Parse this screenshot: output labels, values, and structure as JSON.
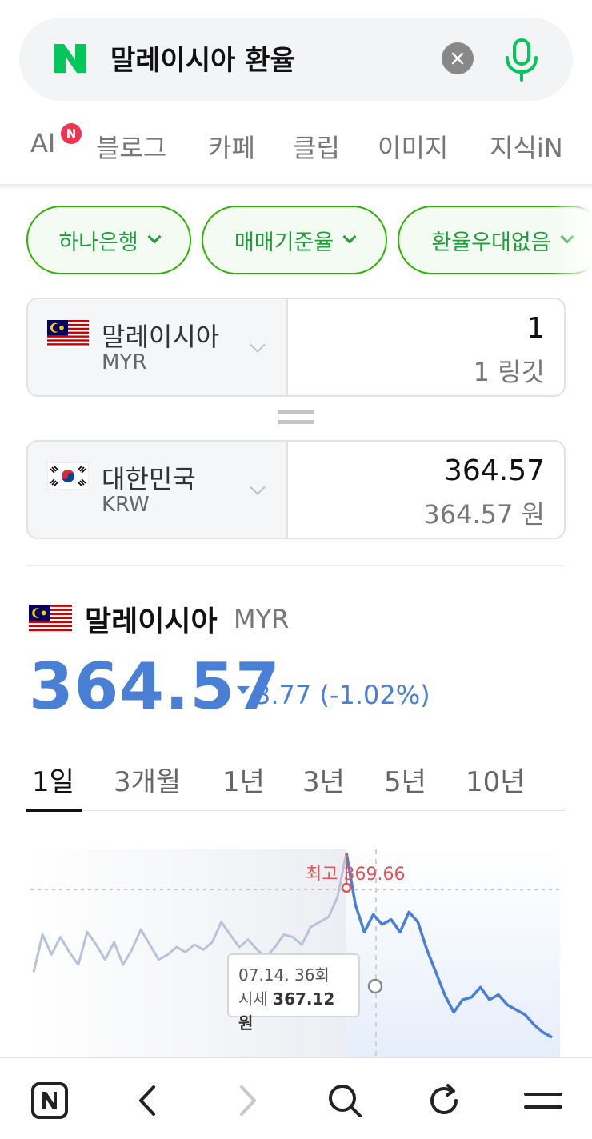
{
  "search": {
    "query": "말레이시아 환율",
    "colors": {
      "brand": "#03c75a",
      "mic": "#03c75a"
    }
  },
  "tabs": [
    {
      "label": "AI",
      "badge": "N"
    },
    {
      "label": "블로그"
    },
    {
      "label": "카페"
    },
    {
      "label": "클립"
    },
    {
      "label": "이미지"
    },
    {
      "label": "지식iN"
    }
  ],
  "filters": {
    "bank": "하나은행",
    "rate_type": "매매기준율",
    "discount": "환율우대없음"
  },
  "converter": {
    "from": {
      "country": "말레이시아",
      "code": "MYR",
      "amount": "1",
      "amount_text": "1 링깃"
    },
    "to": {
      "country": "대한민국",
      "code": "KRW",
      "amount": "364.57",
      "amount_text": "364.57 원"
    }
  },
  "rate": {
    "country": "말레이시아",
    "code": "MYR",
    "value": "364.57",
    "change": "3.77 (-1.02%)",
    "direction": "down"
  },
  "periods": [
    "1일",
    "3개월",
    "1년",
    "3년",
    "5년",
    "10년"
  ],
  "active_period": "1일",
  "chart_data": {
    "type": "line",
    "series": [
      {
        "values": [
          364.9,
          366.4,
          365.6,
          366.3,
          365.7,
          365.2,
          366.5,
          366.0,
          365.4,
          366.1,
          365.2,
          365.8,
          366.6,
          366.0,
          365.4,
          365.6,
          365.9,
          365.7,
          366.0,
          365.8,
          366.1,
          366.9,
          366.4,
          365.9,
          366.2,
          365.8,
          365.5,
          365.9,
          366.4,
          366.3,
          366.0,
          366.7,
          366.9,
          367.1,
          367.9,
          369.66,
          367.6,
          366.5,
          367.2,
          366.8,
          367.0,
          366.5,
          367.3,
          366.9,
          365.8,
          364.9,
          364.0,
          363.3,
          363.8,
          363.9,
          364.3,
          363.8,
          364.0,
          363.6,
          363.4,
          363.2,
          362.8,
          362.5,
          362.3
        ]
      }
    ],
    "ylim": [
      361.5,
      370.5
    ],
    "reference_line": 368.2,
    "max_label": "최고 369.66",
    "max_value": 369.66,
    "max_index": 35,
    "tooltip": {
      "date": "07.14. 36회",
      "label": "시세",
      "value": "367.12원"
    },
    "colors": {
      "past": "#b8c2d8",
      "future": "#4a7fd6",
      "max": "#e05555"
    }
  },
  "bottom_nav": [
    "home-n-icon",
    "back-icon",
    "forward-icon",
    "search-icon",
    "refresh-icon",
    "menu-icon"
  ]
}
